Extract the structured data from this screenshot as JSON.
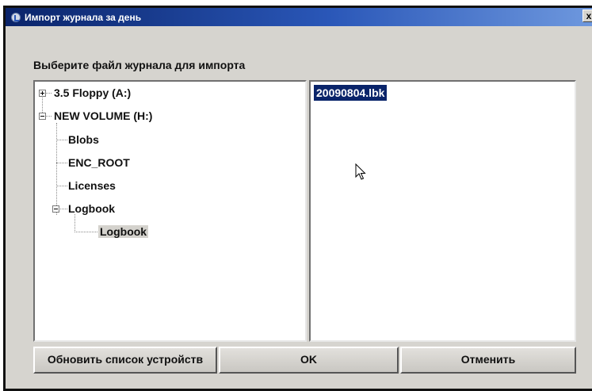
{
  "window": {
    "title": "Импорт журнала за день",
    "close_label": "x"
  },
  "prompt": "Выберите файл журнала для импорта",
  "tree": {
    "items": [
      {
        "label": "3.5 Floppy (A:)",
        "expanded": false
      },
      {
        "label": "NEW VOLUME (H:)",
        "expanded": true
      },
      {
        "label": "Blobs"
      },
      {
        "label": "ENC_ROOT"
      },
      {
        "label": "Licenses"
      },
      {
        "label": "Logbook",
        "expanded": true
      },
      {
        "label": "Logbook",
        "selected": true
      }
    ]
  },
  "files": [
    {
      "name": "20090804.lbk",
      "selected": true
    }
  ],
  "buttons": {
    "refresh": "Обновить список устройств",
    "ok": "OK",
    "cancel": "Отменить"
  },
  "icons": {
    "title": "app-icon",
    "cursor": "mouse-pointer-icon",
    "expand": "plus-box-icon",
    "collapse": "minus-box-icon"
  },
  "colors": {
    "titlebar": "#0a246a",
    "selection": "#0a246a",
    "dialog_bg": "#d6d4cf"
  }
}
